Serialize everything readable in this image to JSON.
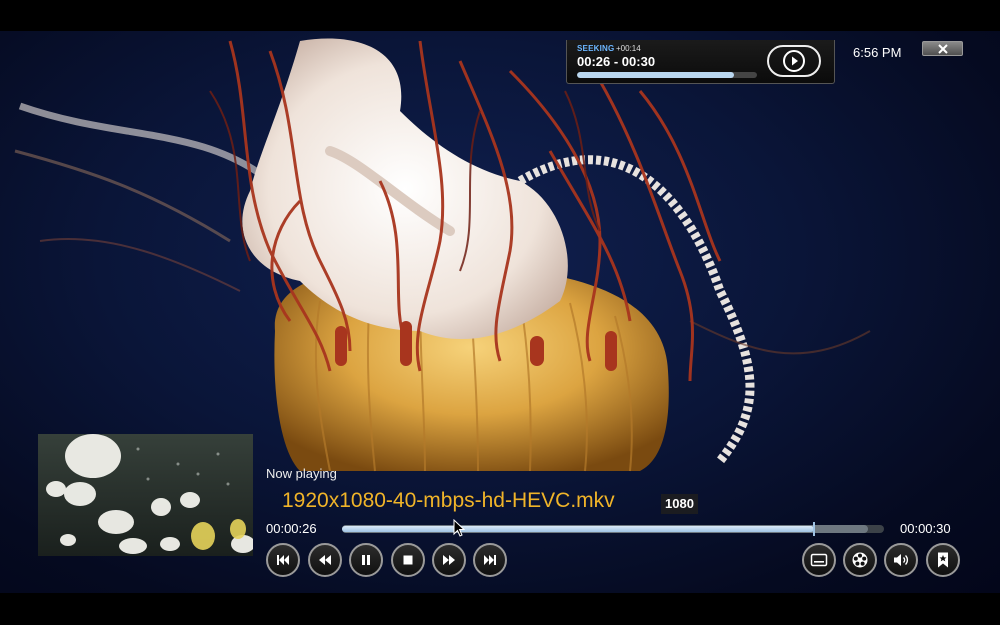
{
  "seek_osd": {
    "status": "SEEKING",
    "delta": "+00:14",
    "range": "00:26 - 00:30",
    "progress_fraction": 0.87,
    "play_icon": "play-circle-icon"
  },
  "clock": "6:56 PM",
  "close_icon": "close-icon",
  "now_playing": {
    "label": "Now playing",
    "title": "1920x1080-40-mbps-hd-HEVC.mkv",
    "resolution": "1080"
  },
  "timeline": {
    "elapsed": "00:00:26",
    "total": "00:00:30",
    "played_fraction": 0.87,
    "cached_fraction": 0.97
  },
  "transport": [
    {
      "name": "skip-previous-icon"
    },
    {
      "name": "rewind-icon"
    },
    {
      "name": "pause-icon"
    },
    {
      "name": "stop-icon"
    },
    {
      "name": "fast-forward-icon"
    },
    {
      "name": "skip-next-icon"
    }
  ],
  "options": [
    {
      "name": "subtitles-icon"
    },
    {
      "name": "video-settings-icon"
    },
    {
      "name": "volume-icon"
    },
    {
      "name": "bookmark-icon"
    }
  ],
  "colors": {
    "title": "#f0b429",
    "seek_status": "#6cb6ff",
    "progress": "#9fc3e4"
  }
}
